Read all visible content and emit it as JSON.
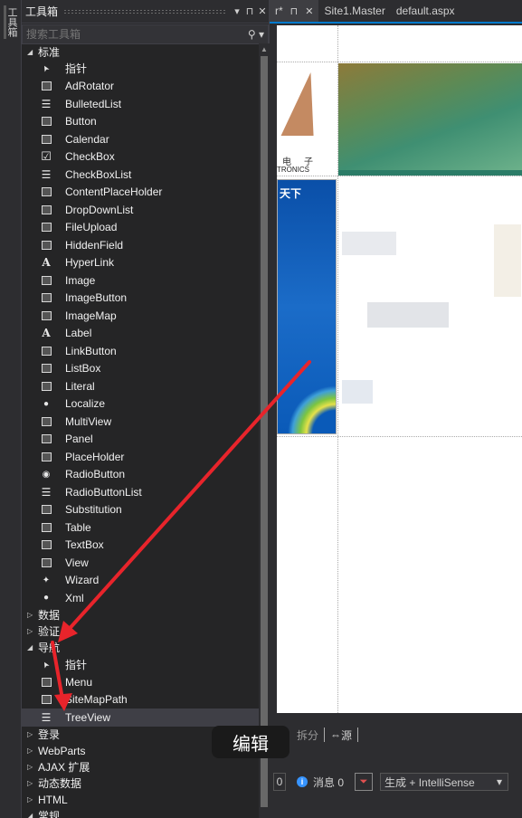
{
  "vertical_tab": {
    "label": "工具箱"
  },
  "toolbox": {
    "title": "工具箱",
    "controls": [
      "▾",
      "⊓",
      "✕"
    ],
    "search_placeholder": "搜索工具箱",
    "categories": [
      {
        "label": "标准",
        "expanded": true,
        "items": [
          {
            "label": "指针",
            "icon": "pointer-icon"
          },
          {
            "label": "AdRotator",
            "icon": "adrotator-icon"
          },
          {
            "label": "BulletedList",
            "icon": "bulleted-list-icon"
          },
          {
            "label": "Button",
            "icon": "button-icon"
          },
          {
            "label": "Calendar",
            "icon": "calendar-icon"
          },
          {
            "label": "CheckBox",
            "icon": "checkbox-icon"
          },
          {
            "label": "CheckBoxList",
            "icon": "checkbox-list-icon"
          },
          {
            "label": "ContentPlaceHolder",
            "icon": "content-placeholder-icon"
          },
          {
            "label": "DropDownList",
            "icon": "dropdown-list-icon"
          },
          {
            "label": "FileUpload",
            "icon": "file-upload-icon"
          },
          {
            "label": "HiddenField",
            "icon": "hidden-field-icon"
          },
          {
            "label": "HyperLink",
            "icon": "hyperlink-icon"
          },
          {
            "label": "Image",
            "icon": "image-icon"
          },
          {
            "label": "ImageButton",
            "icon": "image-button-icon"
          },
          {
            "label": "ImageMap",
            "icon": "image-map-icon"
          },
          {
            "label": "Label",
            "icon": "label-icon"
          },
          {
            "label": "LinkButton",
            "icon": "link-button-icon"
          },
          {
            "label": "ListBox",
            "icon": "listbox-icon"
          },
          {
            "label": "Literal",
            "icon": "literal-icon"
          },
          {
            "label": "Localize",
            "icon": "localize-icon"
          },
          {
            "label": "MultiView",
            "icon": "multiview-icon"
          },
          {
            "label": "Panel",
            "icon": "panel-icon"
          },
          {
            "label": "PlaceHolder",
            "icon": "placeholder-icon"
          },
          {
            "label": "RadioButton",
            "icon": "radio-button-icon"
          },
          {
            "label": "RadioButtonList",
            "icon": "radio-button-list-icon"
          },
          {
            "label": "Substitution",
            "icon": "substitution-icon"
          },
          {
            "label": "Table",
            "icon": "table-icon"
          },
          {
            "label": "TextBox",
            "icon": "textbox-icon"
          },
          {
            "label": "View",
            "icon": "view-icon"
          },
          {
            "label": "Wizard",
            "icon": "wizard-icon"
          },
          {
            "label": "Xml",
            "icon": "xml-icon"
          }
        ]
      },
      {
        "label": "数据",
        "expanded": false,
        "items": []
      },
      {
        "label": "验证",
        "expanded": false,
        "items": []
      },
      {
        "label": "导航",
        "expanded": true,
        "items": [
          {
            "label": "指针",
            "icon": "pointer-icon"
          },
          {
            "label": "Menu",
            "icon": "menu-icon"
          },
          {
            "label": "SiteMapPath",
            "icon": "sitemap-path-icon"
          },
          {
            "label": "TreeView",
            "icon": "treeview-icon",
            "selected": true
          }
        ]
      },
      {
        "label": "登录",
        "expanded": false,
        "items": []
      },
      {
        "label": "WebParts",
        "expanded": false,
        "items": []
      },
      {
        "label": "AJAX 扩展",
        "expanded": false,
        "items": []
      },
      {
        "label": "动态数据",
        "expanded": false,
        "items": []
      },
      {
        "label": "HTML",
        "expanded": false,
        "items": []
      },
      {
        "label": "常规",
        "expanded": true,
        "items": []
      }
    ]
  },
  "editor": {
    "tabs": [
      {
        "label": "r*",
        "active": true,
        "closable": true
      },
      {
        "label": "Site1.Master",
        "active": false
      },
      {
        "label": "default.aspx",
        "active": false
      }
    ],
    "logo_cn": "电子",
    "logo_en": "TRONICS",
    "panel_title": "天下",
    "view_bar": {
      "split": "拆分",
      "source": "源"
    }
  },
  "status": {
    "errors": "0",
    "messages_label": "消息 0",
    "build_filter": "生成 + IntelliSense"
  },
  "tooltip": "编辑",
  "colors": {
    "accent": "#007acc",
    "arrow": "#e8242b",
    "panel_bg": "#252526",
    "selected_bg": "#3f3f46"
  }
}
